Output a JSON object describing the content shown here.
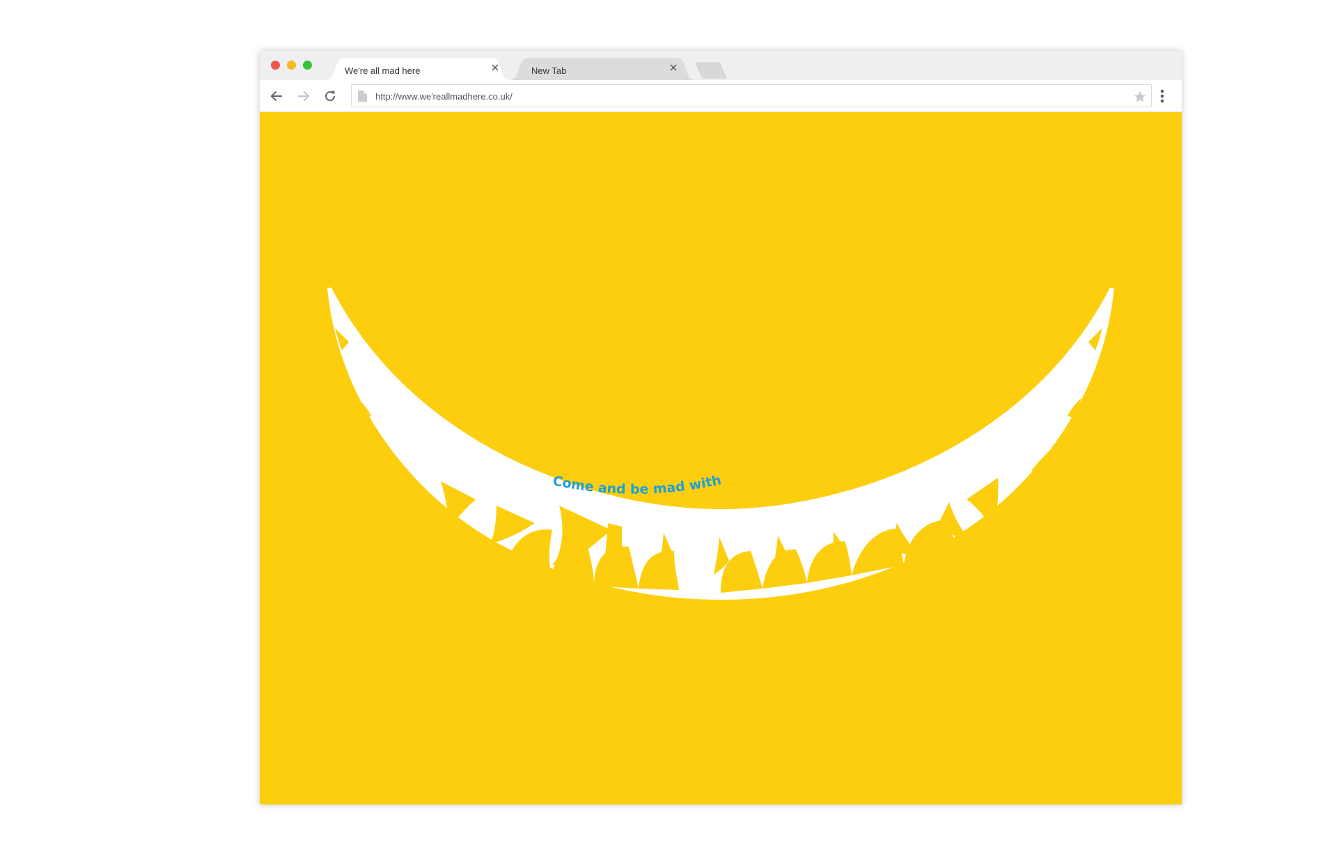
{
  "colors": {
    "page_background": "#ffffff",
    "content_background": "#fdce0d",
    "teeth": "#ffffff",
    "tagline": "#1ea0d8",
    "close_red": "#f2564e",
    "minimize_yellow": "#f6b91f",
    "maximize_green": "#35c33c"
  },
  "window_controls": {
    "close_icon": "close-dot",
    "minimize_icon": "minimize-dot",
    "maximize_icon": "maximize-dot"
  },
  "tabs": [
    {
      "title": "We're all mad here",
      "active": true,
      "close_icon": "x-icon"
    },
    {
      "title": "New Tab",
      "active": false,
      "close_icon": "x-icon"
    }
  ],
  "toolbar": {
    "back_icon": "arrow-left-icon",
    "forward_icon": "arrow-right-icon",
    "reload_icon": "reload-icon",
    "page_icon": "document-icon",
    "url": "http://www.we'reallmadhere.co.uk/",
    "bookmark_icon": "star-icon",
    "menu_icon": "vertical-dots-icon"
  },
  "content": {
    "artwork": "grinning-teeth-smile",
    "tagline": "Come and be mad with us"
  }
}
